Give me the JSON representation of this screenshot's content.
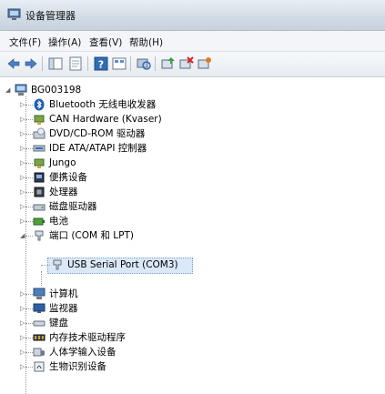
{
  "window": {
    "title": "设备管理器"
  },
  "menu": [
    {
      "label": "文件(F)"
    },
    {
      "label": "操作(A)"
    },
    {
      "label": "查看(V)"
    },
    {
      "label": "帮助(H)"
    }
  ],
  "toolbar": [
    {
      "icon": "back-arrow-icon"
    },
    {
      "icon": "forward-arrow-icon"
    },
    {
      "icon": "console-tree-icon"
    },
    {
      "icon": "properties-icon"
    },
    {
      "icon": "help-icon"
    },
    {
      "icon": "view-icon"
    },
    {
      "icon": "scan-hardware-icon"
    },
    {
      "icon": "update-driver-icon"
    },
    {
      "icon": "disable-device-icon"
    },
    {
      "icon": "uninstall-device-icon"
    }
  ],
  "tree": {
    "root": "BG003198",
    "items": [
      {
        "label": "Bluetooth 无线电收发器",
        "icon": "bluetooth-icon"
      },
      {
        "label": "CAN Hardware (Kvaser)",
        "icon": "network-adapter-icon"
      },
      {
        "label": "DVD/CD-ROM 驱动器",
        "icon": "dvd-drive-icon"
      },
      {
        "label": "IDE ATA/ATAPI 控制器",
        "icon": "ide-controller-icon"
      },
      {
        "label": "Jungo",
        "icon": "device-icon"
      },
      {
        "label": "便携设备",
        "icon": "portable-device-icon"
      },
      {
        "label": "处理器",
        "icon": "processor-icon"
      },
      {
        "label": "磁盘驱动器",
        "icon": "disk-drive-icon"
      },
      {
        "label": "电池",
        "icon": "battery-icon"
      },
      {
        "label": "端口 (COM 和 LPT)",
        "icon": "port-icon"
      },
      {
        "label": "USB Serial Port (COM3)",
        "icon": "port-icon"
      },
      {
        "label": "计算机",
        "icon": "computer-icon"
      },
      {
        "label": "监视器",
        "icon": "monitor-icon"
      },
      {
        "label": "键盘",
        "icon": "keyboard-icon"
      },
      {
        "label": "内存技术驱动程序",
        "icon": "memory-icon"
      },
      {
        "label": "人体学输入设备",
        "icon": "hid-icon"
      },
      {
        "label": "生物识别设备",
        "icon": "biometric-icon"
      }
    ]
  }
}
